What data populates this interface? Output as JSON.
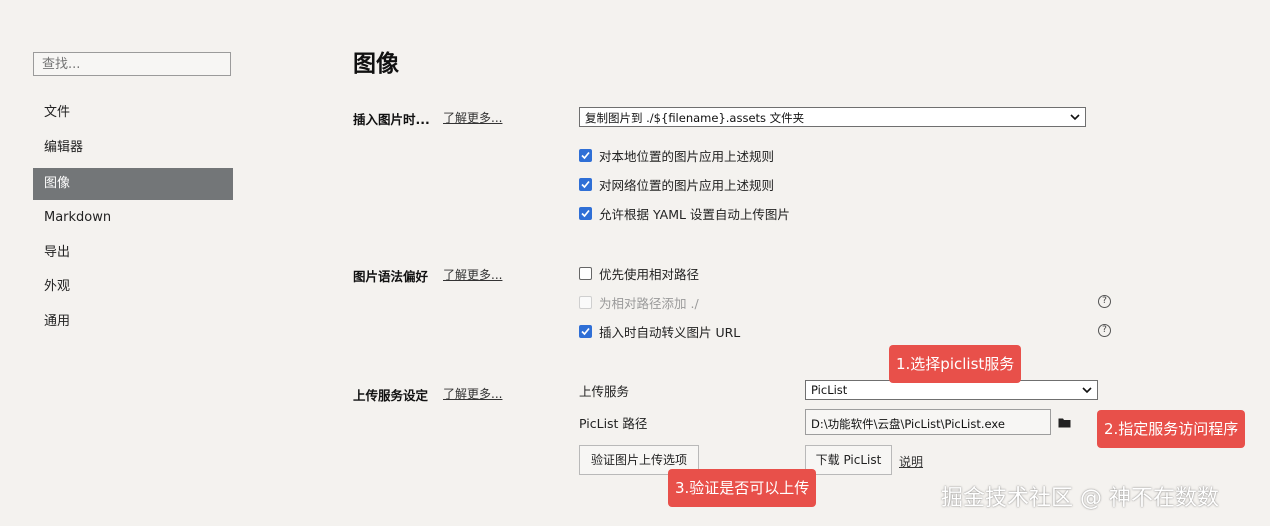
{
  "sidebar": {
    "search_placeholder": "查找...",
    "items": [
      {
        "label": "文件",
        "active": false
      },
      {
        "label": "编辑器",
        "active": false
      },
      {
        "label": "图像",
        "active": true
      },
      {
        "label": "Markdown",
        "active": false
      },
      {
        "label": "导出",
        "active": false
      },
      {
        "label": "外观",
        "active": false
      },
      {
        "label": "通用",
        "active": false
      }
    ]
  },
  "main": {
    "title": "图像",
    "insert_section": {
      "title": "插入图片时...",
      "learn_more": "了解更多...",
      "select_value": "复制图片到 ./${filename}.assets 文件夹",
      "options": [
        {
          "label": "对本地位置的图片应用上述规则",
          "checked": true
        },
        {
          "label": "对网络位置的图片应用上述规则",
          "checked": true
        },
        {
          "label": "允许根据 YAML 设置自动上传图片",
          "checked": true
        }
      ]
    },
    "syntax_section": {
      "title": "图片语法偏好",
      "learn_more": "了解更多...",
      "options": [
        {
          "label": "优先使用相对路径",
          "checked": false,
          "disabled": false
        },
        {
          "label": "为相对路径添加 ./",
          "checked": false,
          "disabled": true
        },
        {
          "label": "插入时自动转义图片 URL",
          "checked": true,
          "disabled": false
        }
      ],
      "help_glyph": "?"
    },
    "upload_section": {
      "title": "上传服务设定",
      "learn_more": "了解更多...",
      "service_label": "上传服务",
      "service_value": "PicList",
      "path_label": "PicList 路径",
      "path_value": "D:\\功能软件\\云盘\\PicList\\PicList.exe",
      "verify_button": "验证图片上传选项",
      "download_button": "下载 PicList",
      "explain_link": "说明"
    }
  },
  "annotations": {
    "step1": "1.选择piclist服务",
    "step2": "2.指定服务访问程序",
    "step3": "3.验证是否可以上传",
    "color": "#e8504a"
  },
  "watermark": "掘金技术社区 @ 神不在数数",
  "colors": {
    "background": "#f4f2ef",
    "sidebar_active": "#737678",
    "checkbox_on": "#2f6fd6"
  }
}
